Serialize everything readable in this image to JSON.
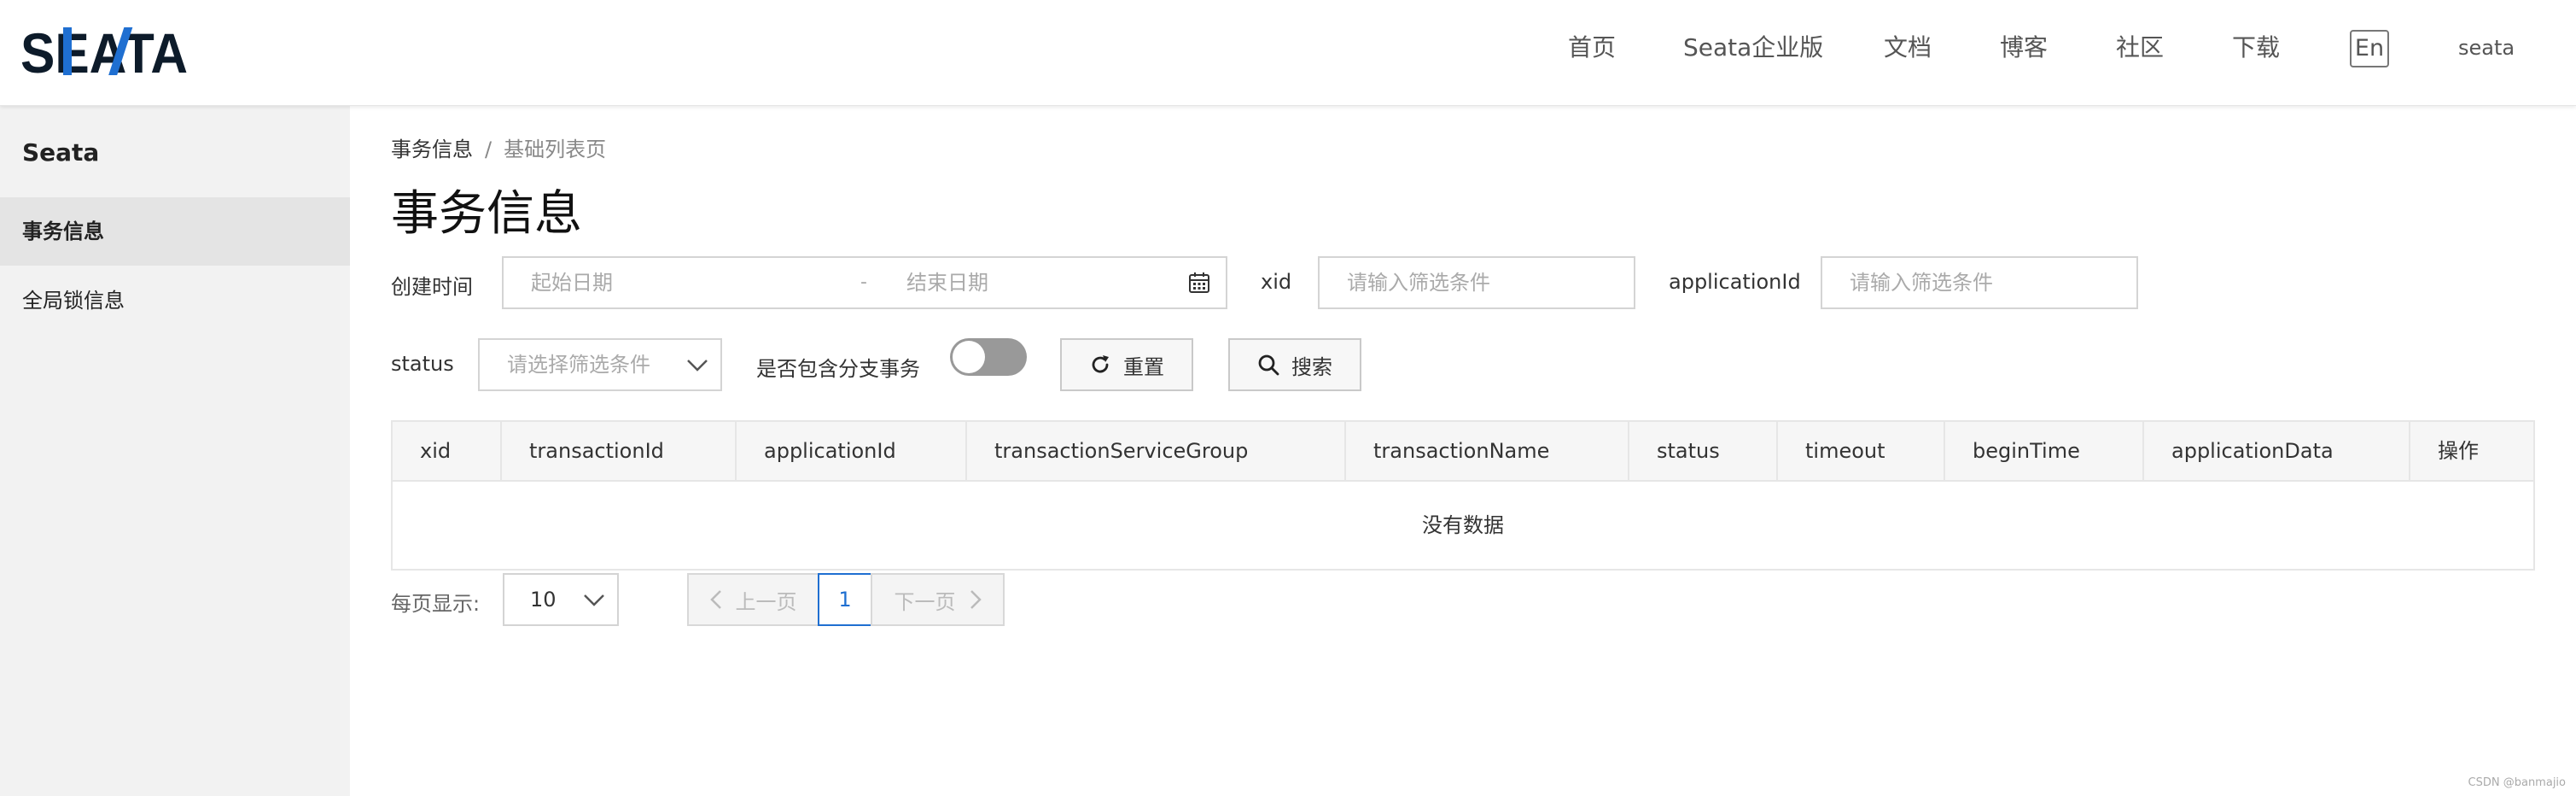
{
  "header": {
    "logo_text": "SEATA",
    "nav": [
      {
        "label": "首页"
      },
      {
        "label": "Seata企业版"
      },
      {
        "label": "文档"
      },
      {
        "label": "博客"
      },
      {
        "label": "社区"
      },
      {
        "label": "下载"
      }
    ],
    "lang_label": "En",
    "user": "seata"
  },
  "sidebar": {
    "title": "Seata",
    "items": [
      {
        "label": "事务信息",
        "active": true
      },
      {
        "label": "全局锁信息",
        "active": false
      }
    ]
  },
  "breadcrumb": {
    "home": "事务信息",
    "separator": "/",
    "current": "基础列表页"
  },
  "page_title": "事务信息",
  "filters": {
    "create_time_label": "创建时间",
    "start_placeholder": "起始日期",
    "range_separator": "-",
    "end_placeholder": "结束日期",
    "xid_label": "xid",
    "xid_placeholder": "请输入筛选条件",
    "app_id_label": "applicationId",
    "app_id_placeholder": "请输入筛选条件",
    "status_label": "status",
    "status_placeholder": "请选择筛选条件",
    "include_branch_label": "是否包含分支事务",
    "include_branch_on": false,
    "reset_label": "重置",
    "search_label": "搜索"
  },
  "table": {
    "columns": [
      "xid",
      "transactionId",
      "applicationId",
      "transactionServiceGroup",
      "transactionName",
      "status",
      "timeout",
      "beginTime",
      "applicationData",
      "操作"
    ],
    "rows": [],
    "empty_text": "没有数据"
  },
  "pagination": {
    "page_size_label": "每页显示:",
    "page_size": "10",
    "prev_label": "上一页",
    "current_page": "1",
    "next_label": "下一页"
  },
  "watermark": "CSDN @banmajio",
  "colors": {
    "brand_blue": "#1f6fd1",
    "logo_dark": "#0d1b2a",
    "sidebar_bg": "#f2f2f2",
    "active_item_bg": "#e4e4e4"
  }
}
